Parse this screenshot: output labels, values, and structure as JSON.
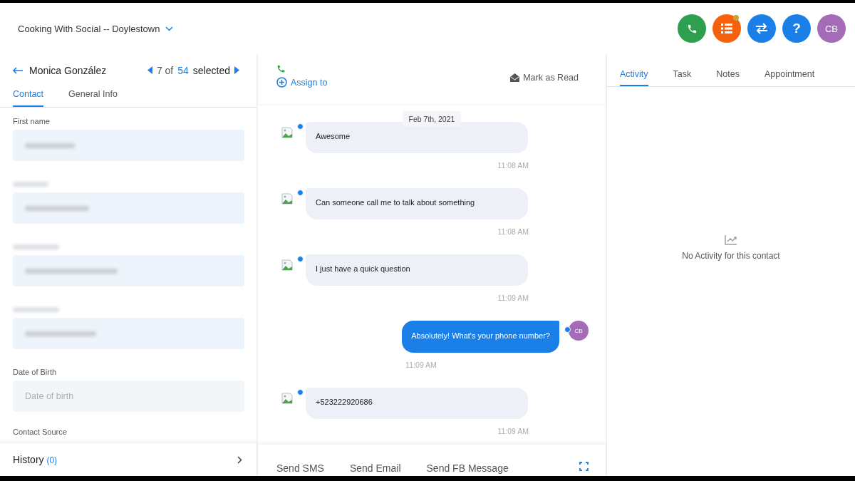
{
  "account": {
    "name": "Cooking With Social -- Doylestown"
  },
  "header_buttons": [
    {
      "kind": "phone",
      "color": "#2e9e4f",
      "badge": false
    },
    {
      "kind": "list",
      "color": "#f4600c",
      "badge": true
    },
    {
      "kind": "swap",
      "color": "#1b7fe8",
      "badge": false
    },
    {
      "kind": "help",
      "color": "#1b7fe8",
      "badge": false,
      "label": "?"
    },
    {
      "kind": "avatar",
      "color": "#a56bb8",
      "badge": false,
      "label": "CB"
    }
  ],
  "contact": {
    "name": "Monica González",
    "pager": {
      "position": "7 of",
      "total": "54",
      "suffix": "selected"
    },
    "tabs": [
      {
        "label": "Contact",
        "selected": true
      },
      {
        "label": "General Info",
        "selected": false
      }
    ],
    "fields": [
      {
        "kind": "redacted-value",
        "label": "First name"
      },
      {
        "kind": "redacted"
      },
      {
        "kind": "redacted"
      },
      {
        "kind": "redacted"
      },
      {
        "kind": "empty",
        "label": "Date of Birth",
        "placeholder": "Date of birth"
      },
      {
        "kind": "label-only",
        "label": "Contact Source"
      }
    ],
    "history": {
      "label": "History",
      "count": "(0)"
    }
  },
  "conversation": {
    "assign": "Assign to",
    "mark_read": "Mark as Read",
    "date": "Feb 7th, 2021",
    "messages": [
      {
        "kind": "received",
        "text": "Awesome",
        "time": "11:08 AM"
      },
      {
        "kind": "received",
        "text": "Can someone call me to talk about something",
        "time": "11:08 AM"
      },
      {
        "kind": "received",
        "text": "I just have a quick question",
        "time": "11:09 AM"
      },
      {
        "kind": "sent",
        "text": "Absolutely! What's your phone number?",
        "time": "11:09 AM",
        "avatar": "CB"
      },
      {
        "kind": "received",
        "text": "+523222920686",
        "time": "11:09 AM"
      }
    ],
    "compose_tabs": [
      "Send SMS",
      "Send Email",
      "Send FB Message"
    ]
  },
  "activity": {
    "tabs": [
      {
        "label": "Activity",
        "selected": true
      },
      {
        "label": "Task",
        "selected": false
      },
      {
        "label": "Notes",
        "selected": false
      },
      {
        "label": "Appointment",
        "selected": false
      }
    ],
    "empty_text": "No Activity for this contact"
  }
}
